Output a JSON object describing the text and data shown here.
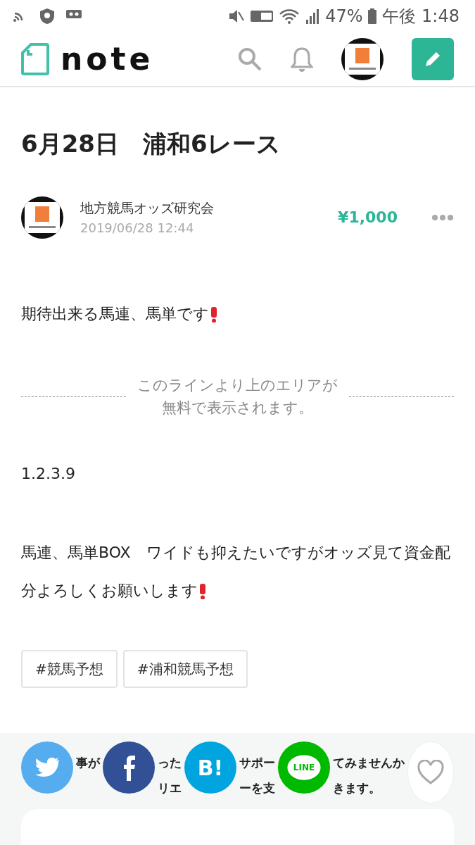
{
  "status_bar": {
    "battery": "47%",
    "time": "午後 1:48"
  },
  "header": {
    "logo": "note"
  },
  "article": {
    "title": "6月28日　浦和6レース",
    "author": "地方競馬オッズ研究会",
    "date": "2019/06/28 12:44",
    "price": "¥1,000",
    "paragraphs": [
      {
        "kind": "text",
        "text": "期待出来る馬連、馬単です",
        "exclaim": true
      },
      {
        "kind": "divider",
        "lines": [
          "このラインより上のエリアが",
          "無料で表示されます。"
        ]
      },
      {
        "kind": "text",
        "text": "1.2.3.9",
        "exclaim": false
      },
      {
        "kind": "text",
        "text": "馬連、馬単BOX　ワイドも抑えたいですがオッズ見て資金配分よろしくお願いします",
        "exclaim": true
      }
    ],
    "tags": [
      "#競馬予想",
      "#浦和競馬予想"
    ]
  },
  "support": {
    "gaps": [
      {
        "top": "事が"
      },
      {
        "top": "った",
        "bottom": "リエ"
      },
      {
        "top": "サポー",
        "bottom": "ーを支"
      },
      {
        "top": "てみませんか",
        "bottom": "きます。"
      }
    ],
    "share": [
      {
        "kind": "twitter"
      },
      {
        "kind": "facebook"
      },
      {
        "kind": "hatena",
        "label": "B!"
      },
      {
        "kind": "line",
        "label": "LINE"
      }
    ],
    "liked": false
  }
}
